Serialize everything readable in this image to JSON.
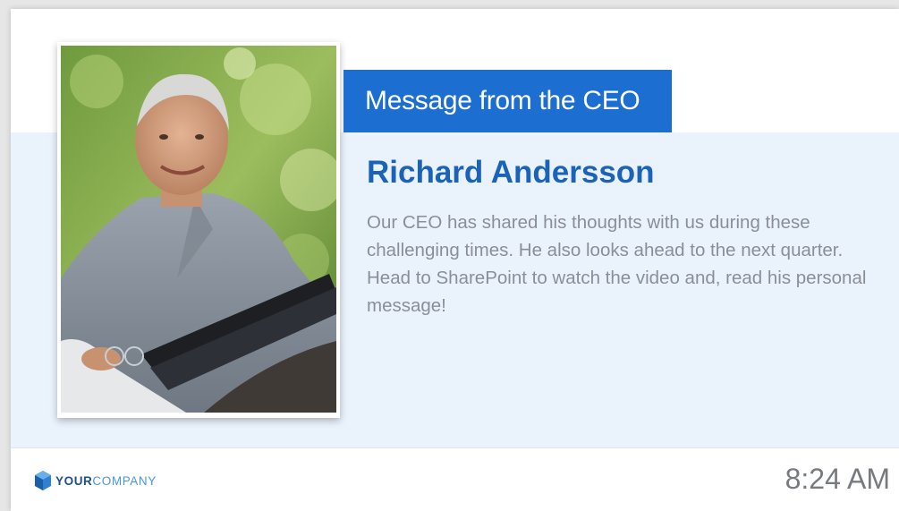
{
  "announcement": {
    "title": "Message from the CEO",
    "name": "Richard Andersson",
    "body": "Our CEO has shared his thoughts with us during these challenging times. He also looks ahead to the next quarter. Head to SharePoint to watch the video and, read his personal message!"
  },
  "photo": {
    "subject": "portrait of man holding laptop"
  },
  "footer": {
    "brand_bold": "YOUR",
    "brand_light": "COMPANY",
    "logo_icon": "company-logo-icon",
    "time": "8:24 AM"
  },
  "colors": {
    "accent": "#1c6fd1",
    "name": "#1a63b8",
    "band": "#eaf2fc"
  }
}
